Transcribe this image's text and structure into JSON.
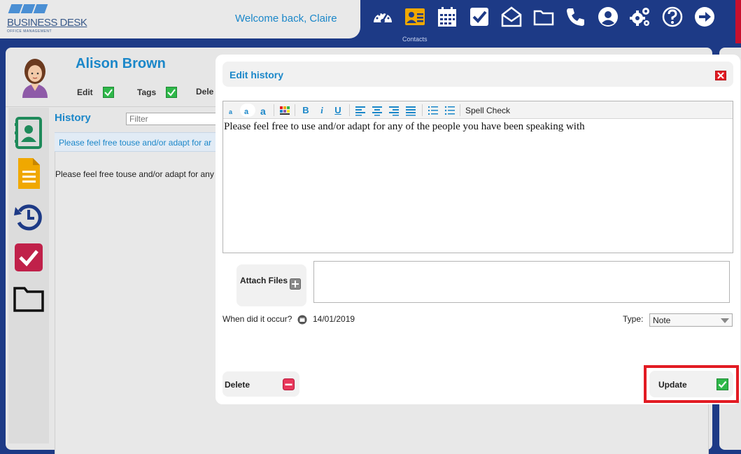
{
  "topbar": {
    "logo_title": "BUSINESS DESK",
    "logo_subtitle": "OFFICE MANAGEMENT",
    "welcome": "Welcome back, Claire",
    "active_caption": "Contacts",
    "nav_icons": [
      "dashboard-icon",
      "contacts-icon",
      "calendar-icon",
      "tasks-check-icon",
      "mail-icon",
      "folder-icon",
      "phone-icon",
      "user-icon",
      "settings-gears-icon",
      "help-icon",
      "logout-arrow-icon"
    ],
    "accent": "#1d3a86",
    "active_icon_color": "#f0a800"
  },
  "contact": {
    "name": "Alison Brown",
    "actions": [
      {
        "label": "Edit"
      },
      {
        "label": "Tags"
      },
      {
        "label": "Dele"
      }
    ]
  },
  "sidebar": {
    "icons": [
      "contact-card-icon",
      "document-icon",
      "history-icon",
      "tasks-icon",
      "folder-icon"
    ]
  },
  "history": {
    "label": "History",
    "filter_placeholder": "Filter",
    "row_title": "Please feel free touse and/or adapt for ar",
    "row_body": "Please feel free touse and/or adapt for any"
  },
  "modal": {
    "title": "Edit history",
    "toolbar": {
      "spell_check": "Spell Check"
    },
    "editor_text": "Please feel free to use and/or adapt for any of the people you have been speaking with",
    "attach_label": "Attach Files",
    "occurred_label": "When did it occur?",
    "occurred_date": "14/01/2019",
    "type_label": "Type:",
    "type_value": "Note",
    "delete_label": "Delete",
    "update_label": "Update",
    "colors": {
      "title": "#1b87c9",
      "close": "#e21b23",
      "highlight": "#e21b23",
      "check": "#2fb84a"
    }
  }
}
